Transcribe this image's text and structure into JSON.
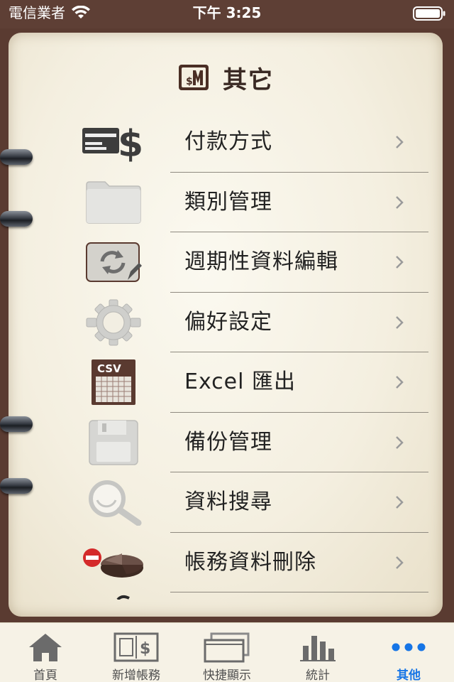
{
  "status_bar": {
    "carrier": "電信業者",
    "time": "下午 3:25"
  },
  "header": {
    "title": "其它",
    "logo_icon": "money-notebook-logo-icon"
  },
  "menu": {
    "items": [
      {
        "label": "付款方式",
        "icon": "card-dollar-icon"
      },
      {
        "label": "類別管理",
        "icon": "folder-icon"
      },
      {
        "label": "週期性資料編輯",
        "icon": "recurring-edit-icon"
      },
      {
        "label": "偏好設定",
        "icon": "gear-icon"
      },
      {
        "label": "Excel 匯出",
        "icon": "csv-icon"
      },
      {
        "label": "備份管理",
        "icon": "floppy-disk-icon"
      },
      {
        "label": "資料搜尋",
        "icon": "magnifier-icon"
      },
      {
        "label": "帳務資料刪除",
        "icon": "delete-pie-icon"
      }
    ]
  },
  "tab_bar": {
    "tabs": [
      {
        "label": "首頁",
        "icon": "home-icon",
        "active": false
      },
      {
        "label": "新增帳務",
        "icon": "add-ledger-icon",
        "active": false
      },
      {
        "label": "快捷顯示",
        "icon": "quick-view-icon",
        "active": false
      },
      {
        "label": "統計",
        "icon": "bar-chart-icon",
        "active": false
      },
      {
        "label": "其他",
        "icon": "more-dots-icon",
        "active": true
      }
    ]
  },
  "colors": {
    "leather": "#5a3b31",
    "paper": "#f4efe0",
    "active_tab": "#1675e6",
    "text": "#222222"
  }
}
